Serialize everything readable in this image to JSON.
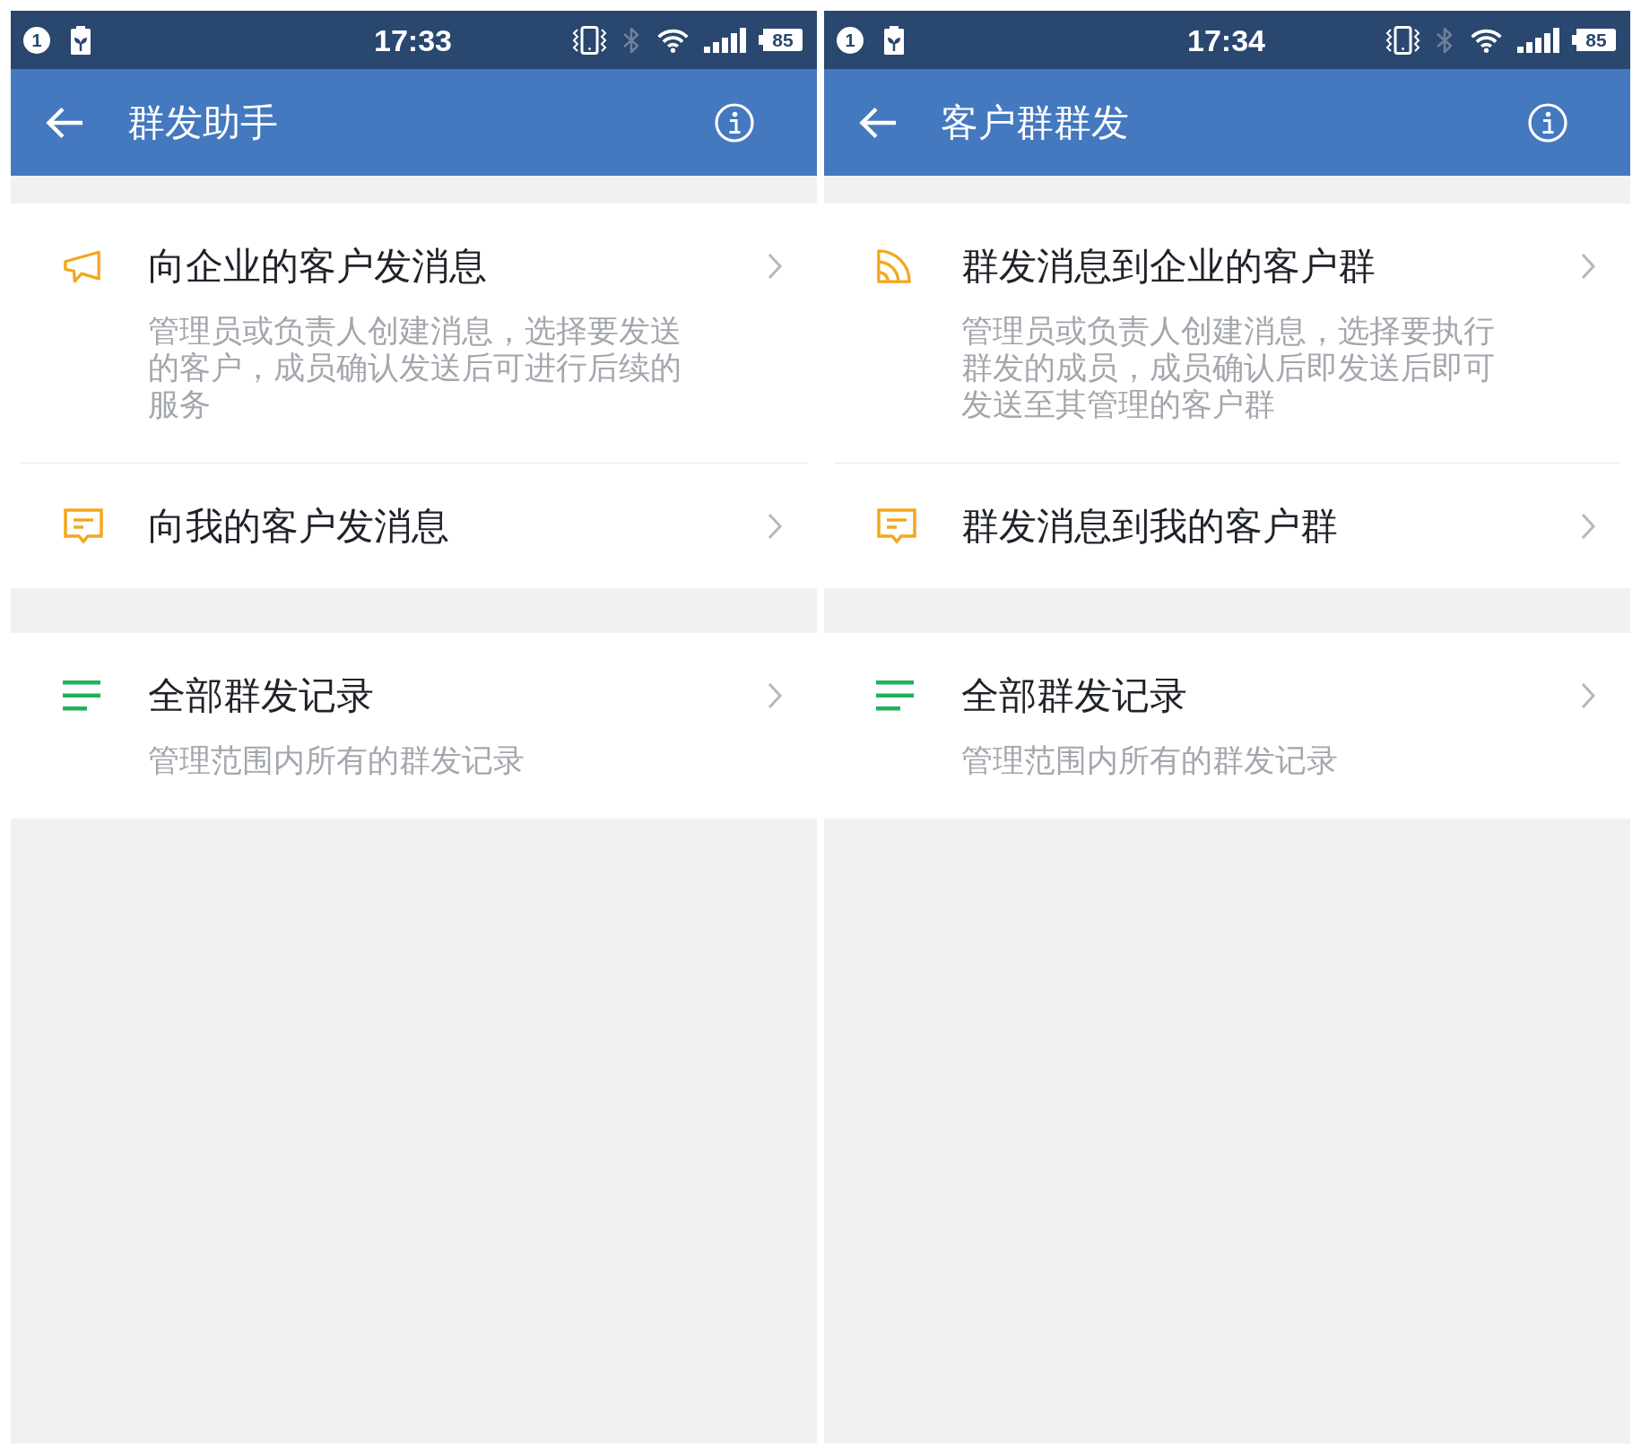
{
  "screens": [
    {
      "status_bar": {
        "notification_count": "1",
        "time": "17:33",
        "bluetooth_on": false,
        "battery": "85"
      },
      "app_bar": {
        "title": "群发助手"
      },
      "sections": [
        {
          "items": [
            {
              "kind": "enterprise_customers",
              "title": "向企业的客户发消息",
              "description": "管理员或负责人创建消息，选择要发送的客户，成员确认发送后可进行后续的服务"
            },
            {
              "kind": "my_customers",
              "title": "向我的客户发消息"
            }
          ]
        },
        {
          "items": [
            {
              "kind": "records",
              "title": "全部群发记录",
              "description": "管理范围内所有的群发记录"
            }
          ]
        }
      ]
    },
    {
      "status_bar": {
        "notification_count": "1",
        "time": "17:34",
        "bluetooth_on": false,
        "battery": "85"
      },
      "app_bar": {
        "title": "客户群群发"
      },
      "sections": [
        {
          "items": [
            {
              "kind": "enterprise_groups",
              "title": "群发消息到企业的客户群",
              "description": "管理员或负责人创建消息，选择要执行群发的成员，成员确认后即发送后即可发送至其管理的客户群"
            },
            {
              "kind": "my_groups",
              "title": "群发消息到我的客户群"
            }
          ]
        },
        {
          "items": [
            {
              "kind": "records",
              "title": "全部群发记录",
              "description": "管理范围内所有的群发记录"
            }
          ]
        }
      ]
    }
  ]
}
